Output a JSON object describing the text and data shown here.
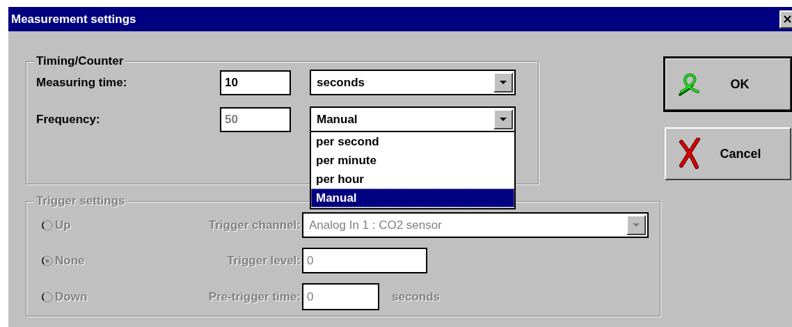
{
  "window": {
    "title": "Measurement settings"
  },
  "timing": {
    "legend": "Timing/Counter",
    "rows": [
      {
        "label": "Measuring time:",
        "value": "10",
        "disabled": false,
        "unit": "seconds"
      },
      {
        "label": "Frequency:",
        "value": "50",
        "disabled": true,
        "unit": "Manual",
        "options": [
          {
            "label": "per second",
            "selected": false
          },
          {
            "label": "per minute",
            "selected": false
          },
          {
            "label": "per hour",
            "selected": false
          },
          {
            "label": "Manual",
            "selected": true
          }
        ]
      }
    ]
  },
  "trigger": {
    "legend": "Trigger settings",
    "disabled": true,
    "directions": [
      {
        "label": "Up",
        "selected": false
      },
      {
        "label": "None",
        "selected": true
      },
      {
        "label": "Down",
        "selected": false
      }
    ],
    "channel": {
      "label": "Trigger channel:",
      "value": "Analog In 1 : CO2 sensor"
    },
    "level": {
      "label": "Trigger level:",
      "value": "0"
    },
    "pretrigger": {
      "label": "Pre-trigger time:",
      "value": "0",
      "unit": "seconds"
    }
  },
  "buttons": [
    {
      "kind": "ok",
      "label": "OK",
      "default": true
    },
    {
      "kind": "cancel",
      "label": "Cancel",
      "default": false
    }
  ]
}
